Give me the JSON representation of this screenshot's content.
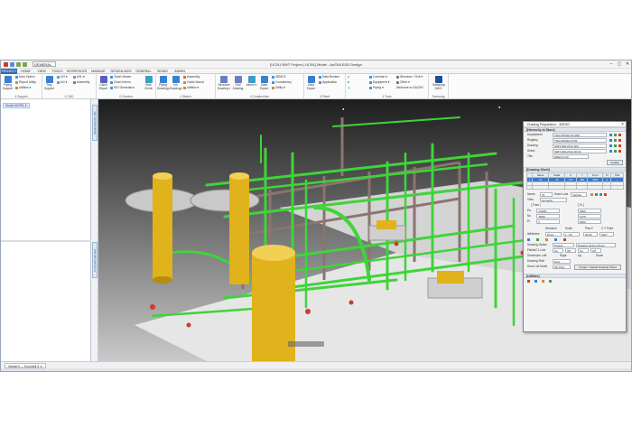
{
  "window": {
    "title": "[UCN1 BWT Project | UCN1] Model - AnSVA EDD Design",
    "qa_select": "GENERAL",
    "controls": [
      "–",
      "▢",
      "✕"
    ]
  },
  "tabs": [
    "PROJECT",
    "HOME",
    "VIEW",
    "TOOLS",
    "INTERFACES",
    "MANAGE",
    "DESIGN AIDS",
    "GENERAL",
    "SIZING",
    "ADMIN"
  ],
  "ribbon": {
    "groups": [
      {
        "label": "4 Support",
        "buttons": [
          {
            "label": "Piping Support",
            "type": "big"
          }
        ],
        "small": [
          "User Option",
          "Report Utility",
          "Utilities ▾"
        ]
      },
      {
        "label": "4 CAD",
        "buttons": [
          {
            "label": "Tray Support",
            "type": "big"
          }
        ],
        "small": [
          "UG ▾",
          "ASL ▾",
          "AG ▾",
          "Assembly"
        ]
      },
      {
        "label": "4 Checker",
        "buttons": [
          {
            "label": "Clash Export",
            "type": "big"
          },
          {
            "label": "Rule Check",
            "type": "big"
          }
        ],
        "small": [
          "Clash Viewer",
          "Clash Inform",
          "ISO Generation"
        ]
      },
      {
        "label": "4 Sketch",
        "buttons": [
          {
            "label": "Piping Drawings",
            "type": "big"
          },
          {
            "label": "Iso Drawings",
            "type": "big"
          }
        ],
        "small": [
          "Assembly",
          "Cable Manut",
          "Utilities ▾"
        ]
      },
      {
        "label": "4 Construction",
        "buttons": [
          {
            "label": "Structure Drawing ▾",
            "type": "big"
          },
          {
            "label": "Civil Drawing",
            "type": "big"
          },
          {
            "label": "Inform ▾",
            "type": "big"
          },
          {
            "label": "Data Export",
            "type": "big"
          }
        ],
        "small": [
          "3DMCS",
          "Consistency",
          "Utility ▾"
        ]
      },
      {
        "label": "4 Sheet",
        "buttons": [
          {
            "label": "Data Export",
            "type": "big"
          }
        ],
        "small": [
          "Data Review",
          "Application"
        ]
      },
      {
        "label": "4 Tools",
        "buttons": [],
        "small": [
          "Common ▾",
          "Equipment ▾",
          "Piping ▾",
          "Structure / Civil ▾",
          "Other ▾",
          "Welcome to SACNS"
        ]
      },
      {
        "label": "Samsung",
        "buttons": [
          {
            "label": "Samsung DWG",
            "type": "big"
          }
        ],
        "small": []
      }
    ]
  },
  "left_pane": {
    "tree_item": "Model WORL ▾"
  },
  "side_tabs": [
    "Model Explorer (M)",
    "Command Window"
  ],
  "view_tab": "Viewer3 — Ecoshell 3 ✕",
  "dialog": {
    "title": "Drawing Preparation - 3DESO",
    "sections": {
      "hierarchy": "[Hierarchy in Store]",
      "drawing_sheet": "[Drawing Sheet]",
      "utilities": "[Utilities]"
    },
    "hierarchy": [
      {
        "label": "Department",
        "value": "TRU-PIPING PLANS"
      },
      {
        "label": "Registry",
        "value": "TRU-PIPING PT02"
      },
      {
        "label": "Drawing",
        "value": "SMIT-3D1-PGU-001"
      },
      {
        "label": "Sheet",
        "value": "SMIT-3D1-PGU-00 01"
      },
      {
        "label": "Title",
        "value": "DRES P-03"
      }
    ],
    "update_button": "Update",
    "sheet_table": {
      "headers": [
        "",
        "Name",
        "Scale",
        "X",
        "Y",
        "Front",
        "Tx",
        "Title"
      ],
      "rows": [
        [
          "1",
          "V1",
          "25",
          "270",
          "480",
          "3450",
          "0",
          "—"
        ]
      ]
    },
    "name_label": "Name",
    "name_value": "V1",
    "direction_label": "Draw Look",
    "direction_value": "Vertical",
    "view_label": "View",
    "view_value": "Isometric",
    "from_to_headers": [
      "[ From ]",
      "[ To ]"
    ],
    "from_rows": [
      {
        "axis": "Ea",
        "from": "-10000",
        "to": "3000"
      },
      {
        "axis": "No",
        "from": "-5000",
        "to": "1375"
      },
      {
        "axis": "El",
        "from": "0",
        "to": "9400"
      }
    ],
    "attr_headers": [
      "Direction",
      "Scale",
      "Plan F",
      "X Y Point"
    ],
    "attr_values": [
      "Down",
      "1 : 50",
      "29.56",
      "3457"
    ],
    "attributes_label": "Attributes",
    "drawing_option_label": "Drawing Option",
    "drawing_option_value": "Project",
    "drawing_option_value2": "Drawing Option Piping",
    "fields_label": "Fields/CL Line",
    "fields_values": [
      "On",
      "Off",
      "On",
      "Off"
    ],
    "dim_label": "Dimension Left",
    "dim_options": [
      "Right",
      "Up",
      "Down"
    ],
    "drawing_rule_label": "Drawing Rule",
    "drawing_rule_value": "New",
    "draw_list_label": "Draw List Mode",
    "draw_list_value": "3D View",
    "create_button": "Create / Update Drawing Sheet"
  },
  "colors": {
    "ribbon_tab_active": "#2f6db5",
    "pipe_green": "#3fd43a",
    "vessel_yellow": "#e0b21b",
    "steel": "#8c7470"
  }
}
